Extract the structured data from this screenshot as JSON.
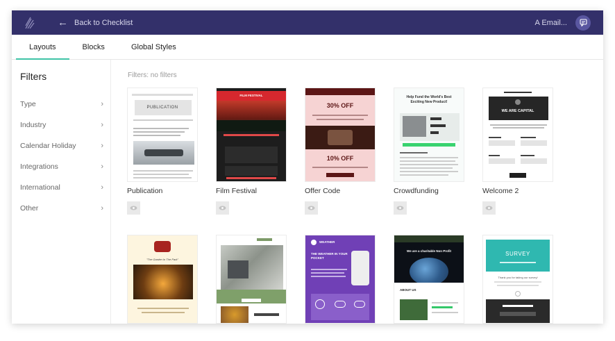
{
  "topbar": {
    "back_label": "Back to Checklist",
    "email_name": "A Email..."
  },
  "tabs": [
    {
      "label": "Layouts",
      "active": true
    },
    {
      "label": "Blocks",
      "active": false
    },
    {
      "label": "Global Styles",
      "active": false
    }
  ],
  "sidebar": {
    "title": "Filters",
    "items": [
      {
        "label": "Type"
      },
      {
        "label": "Industry"
      },
      {
        "label": "Calendar Holiday"
      },
      {
        "label": "Integrations"
      },
      {
        "label": "International"
      },
      {
        "label": "Other"
      }
    ]
  },
  "main": {
    "filters_line": "Filters: no filters",
    "templates": [
      {
        "name": "Publication",
        "t1": "PUBLICATION"
      },
      {
        "name": "Film Festival",
        "t1": "FILM FESTIVAL"
      },
      {
        "name": "Offer Code",
        "t1": "30% OFF",
        "t2": "10% OFF"
      },
      {
        "name": "Crowdfunding",
        "t1": "Help Fund the World's Best Exciting New Product!"
      },
      {
        "name": "Welcome 2",
        "t1": "WE ARE CAPITAL"
      },
      {
        "name": "",
        "t1": "\"The Garden In The Park\""
      },
      {
        "name": ""
      },
      {
        "name": "",
        "t1": "WEATHER",
        "t2": "THE WEATHER IN YOUR POCKET"
      },
      {
        "name": "",
        "t1": "We are a charitable Non Profit",
        "t2": "ABOUT US"
      },
      {
        "name": "",
        "t1": "SURVEY",
        "t2": "Thank you for taking our survey!"
      }
    ]
  },
  "colors": {
    "topbar": "#33306a",
    "accent": "#3ec3a6"
  }
}
